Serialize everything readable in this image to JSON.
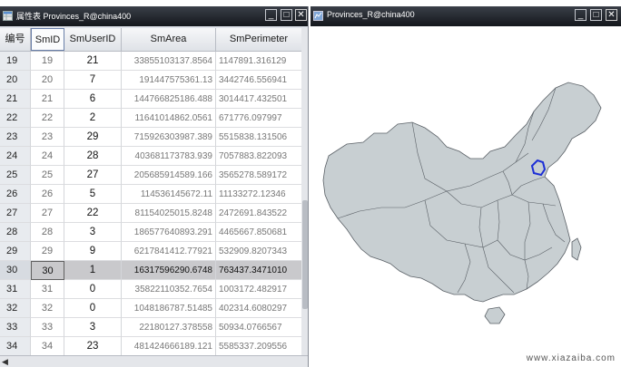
{
  "left_window": {
    "title": "属性表 Provinces_R@china400",
    "columns": [
      "编号",
      "SmID",
      "SmUserID",
      "SmArea",
      "SmPerimeter"
    ],
    "selected_row_index": 11,
    "rows": [
      {
        "num": "19",
        "smid": "19",
        "user": "21",
        "area": "33855103137.8564",
        "perim": "1147891.316129"
      },
      {
        "num": "20",
        "smid": "20",
        "user": "7",
        "area": "191447575361.13",
        "perim": "3442746.556941"
      },
      {
        "num": "21",
        "smid": "21",
        "user": "6",
        "area": "144766825186.488",
        "perim": "3014417.432501"
      },
      {
        "num": "22",
        "smid": "22",
        "user": "2",
        "area": "11641014862.0561",
        "perim": "671776.097997"
      },
      {
        "num": "23",
        "smid": "23",
        "user": "29",
        "area": "715926303987.389",
        "perim": "5515838.131506"
      },
      {
        "num": "24",
        "smid": "24",
        "user": "28",
        "area": "403681173783.939",
        "perim": "7057883.822093"
      },
      {
        "num": "25",
        "smid": "25",
        "user": "27",
        "area": "205685914589.166",
        "perim": "3565278.589172"
      },
      {
        "num": "26",
        "smid": "26",
        "user": "5",
        "area": "114536145672.11",
        "perim": "11133272.12346"
      },
      {
        "num": "27",
        "smid": "27",
        "user": "22",
        "area": "81154025015.8248",
        "perim": "2472691.843522"
      },
      {
        "num": "28",
        "smid": "28",
        "user": "3",
        "area": "186577640893.291",
        "perim": "4465667.850681"
      },
      {
        "num": "29",
        "smid": "29",
        "user": "9",
        "area": "6217841412.77921",
        "perim": "532909.8207343"
      },
      {
        "num": "30",
        "smid": "30",
        "user": "1",
        "area": "16317596290.6748",
        "perim": "763437.3471010"
      },
      {
        "num": "31",
        "smid": "31",
        "user": "0",
        "area": "35822110352.7654",
        "perim": "1003172.482917"
      },
      {
        "num": "32",
        "smid": "32",
        "user": "0",
        "area": "1048186787.51485",
        "perim": "402314.6080297"
      },
      {
        "num": "33",
        "smid": "33",
        "user": "3",
        "area": "22180127.378558",
        "perim": "50934.0766567"
      },
      {
        "num": "34",
        "smid": "34",
        "user": "23",
        "area": "481424666189.121",
        "perim": "5585337.209556"
      }
    ]
  },
  "right_window": {
    "title": "Provinces_R@china400"
  },
  "window_buttons": {
    "minimize": "_",
    "maximize": "□",
    "close": "✕"
  },
  "watermark": "www.xiazaiba.com",
  "colors": {
    "map_fill": "#c8cfd2",
    "map_border": "#5a6066",
    "highlight": "#1d2fd6"
  }
}
